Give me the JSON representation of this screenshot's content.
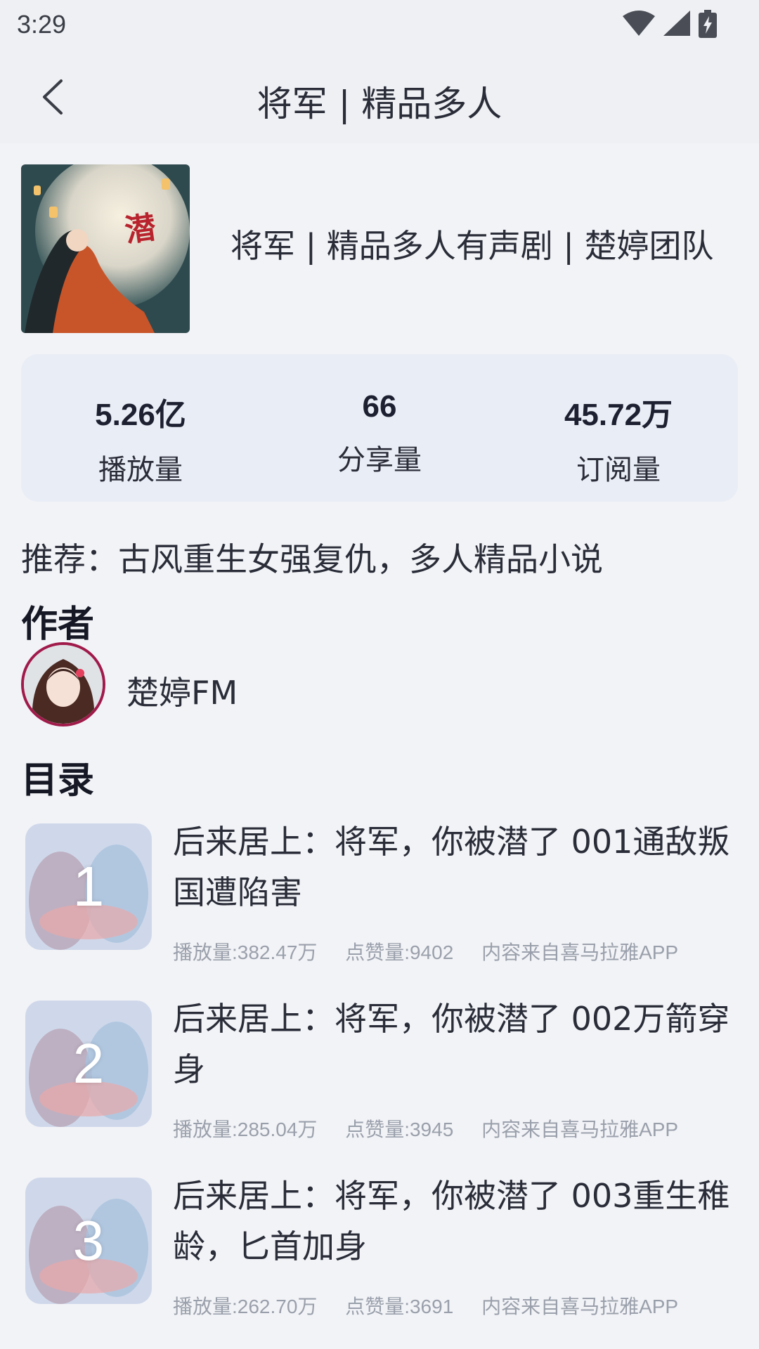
{
  "status": {
    "time": "3:29"
  },
  "header": {
    "title": "将军 | 精品多人"
  },
  "album": {
    "title": "将军 | 精品多人有声剧 | 楚婷团队"
  },
  "stats": [
    {
      "value": "5.26亿",
      "label": "播放量"
    },
    {
      "value": "66",
      "label": "分享量"
    },
    {
      "value": "45.72万",
      "label": "订阅量"
    }
  ],
  "recommend": "推荐：古风重生女强复仇，多人精品小说",
  "author_section": {
    "title": "作者",
    "name": "楚婷FM"
  },
  "catalog_section": {
    "title": "目录"
  },
  "episodes": [
    {
      "num": "1",
      "title": "后来居上：将军，你被潜了 001通敌叛国遭陷害",
      "plays": "播放量:382.47万",
      "likes": "点赞量:9402",
      "source": "内容来自喜马拉雅APP"
    },
    {
      "num": "2",
      "title": "后来居上：将军，你被潜了 002万箭穿身",
      "plays": "播放量:285.04万",
      "likes": "点赞量:3945",
      "source": "内容来自喜马拉雅APP"
    },
    {
      "num": "3",
      "title": "后来居上：将军，你被潜了 003重生稚龄，匕首加身",
      "plays": "播放量:262.70万",
      "likes": "点赞量:3691",
      "source": "内容来自喜马拉雅APP"
    }
  ],
  "icons": {
    "back": "back-arrow-icon",
    "wifi": "wifi-icon",
    "signal": "signal-icon",
    "battery": "battery-charging-icon"
  }
}
